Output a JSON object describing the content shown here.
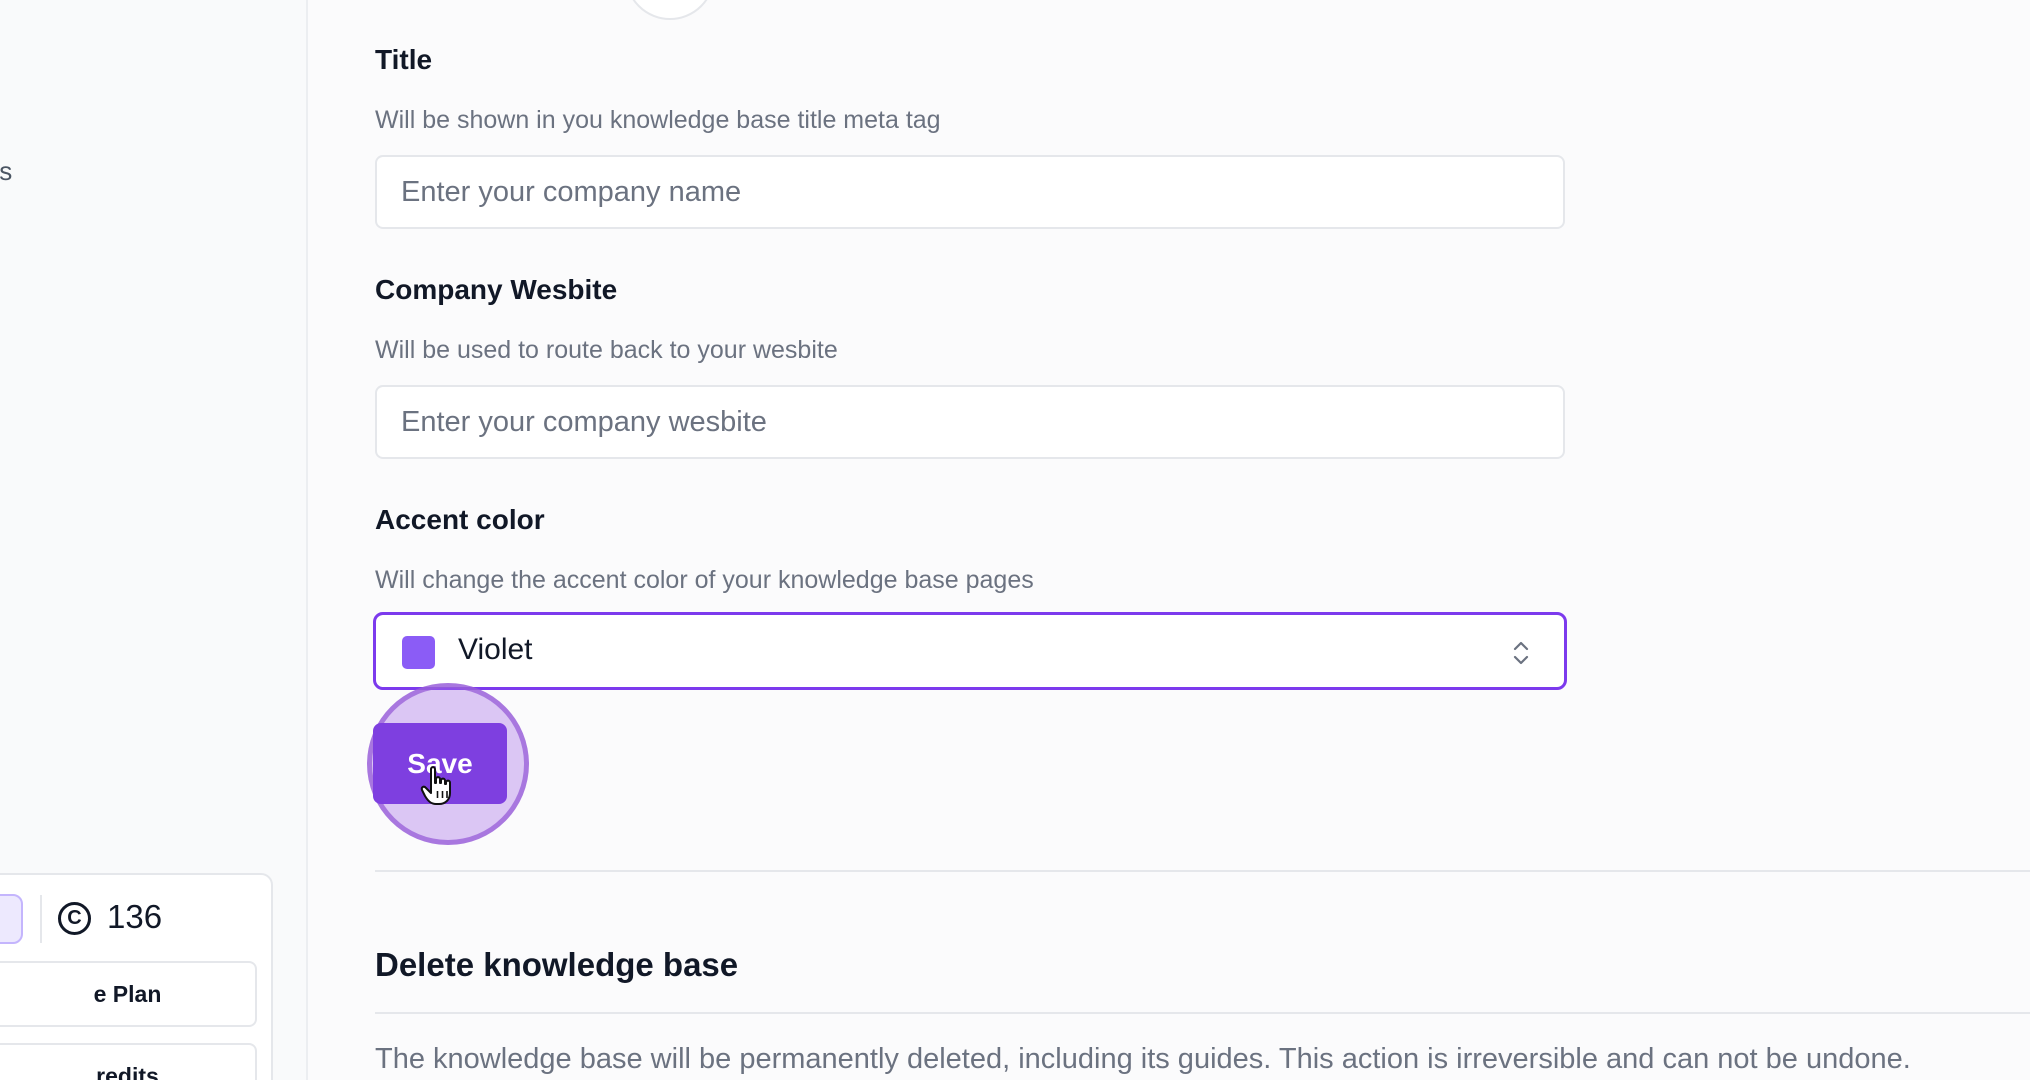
{
  "sidebar": {
    "nav_fragment": "ıs",
    "credits": {
      "count": "136",
      "icon": "credit-c-icon",
      "plan_button": "e Plan",
      "credits_button": "redits"
    }
  },
  "settings": {
    "title": {
      "label": "Title",
      "description": "Will be shown in you knowledge base title meta tag",
      "placeholder": "Enter your company name"
    },
    "website": {
      "label": "Company Wesbite",
      "description": "Will be used to route back to your wesbite",
      "placeholder": "Enter your company wesbite"
    },
    "accent": {
      "label": "Accent color",
      "description": "Will change the accent color of your knowledge base pages",
      "value": "Violet",
      "swatch_color": "#8b5cf6"
    },
    "save_label": "Save"
  },
  "danger": {
    "title": "Delete knowledge base",
    "warning": "The knowledge base will be permanently deleted, including its guides. This action is irreversible and can not be undone."
  },
  "colors": {
    "accent": "#7c3aed",
    "button": "#7e3fe0"
  }
}
